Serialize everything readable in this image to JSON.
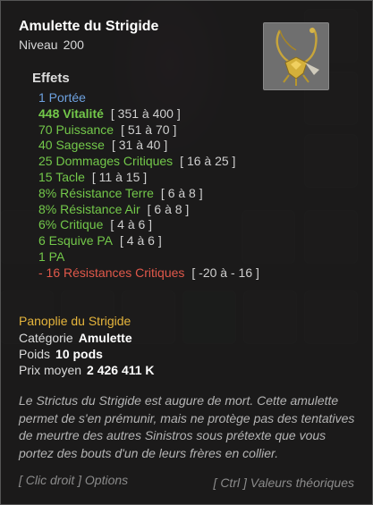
{
  "item": {
    "name": "Amulette du Strigide",
    "level_label": "Niveau",
    "level": "200"
  },
  "effects": {
    "title": "Effets",
    "lines": [
      {
        "text": "1 Portée",
        "range": "",
        "color": "blue",
        "bold": false
      },
      {
        "text": "448 Vitalité",
        "range": "[ 351 à 400 ]",
        "color": "green",
        "bold": true
      },
      {
        "text": "70 Puissance",
        "range": "[ 51 à 70 ]",
        "color": "green",
        "bold": false
      },
      {
        "text": "40 Sagesse",
        "range": "[ 31 à 40 ]",
        "color": "green",
        "bold": false
      },
      {
        "text": "25 Dommages Critiques",
        "range": "[ 16 à 25 ]",
        "color": "green",
        "bold": false
      },
      {
        "text": "15 Tacle",
        "range": "[ 11 à 15 ]",
        "color": "green",
        "bold": false
      },
      {
        "text": "8% Résistance Terre",
        "range": "[ 6 à 8 ]",
        "color": "green",
        "bold": false
      },
      {
        "text": "8% Résistance Air",
        "range": "[ 6 à 8 ]",
        "color": "green",
        "bold": false
      },
      {
        "text": "6% Critique",
        "range": "[ 4 à 6 ]",
        "color": "green",
        "bold": false
      },
      {
        "text": "6 Esquive PA",
        "range": "[ 4 à 6 ]",
        "color": "green",
        "bold": false
      },
      {
        "text": "1 PA",
        "range": "",
        "color": "green",
        "bold": false
      },
      {
        "text": "- 16 Résistances Critiques",
        "range": "[ -20 à - 16 ]",
        "color": "red",
        "bold": false
      }
    ]
  },
  "set": {
    "name": "Panoplie du Strigide"
  },
  "details": {
    "category_label": "Catégorie",
    "category_value": "Amulette",
    "weight_label": "Poids",
    "weight_value": "10 pods",
    "price_label": "Prix moyen",
    "price_value": "2 426 411 K"
  },
  "description": "Le Strictus du Strigide est augure de mort. Cette amulette permet de s'en prémunir, mais ne protège pas des tentatives de meurtre des autres Sinistros sous prétexte que vous portez des bouts d'un de leurs frères en collier.",
  "hints": {
    "left": "[ Clic droit ] Options",
    "right": "[ Ctrl ] Valeurs théoriques"
  },
  "colors": {
    "blue": "#6ea2e0",
    "green": "#73c84a",
    "red": "#e0584a",
    "gold": "#e6b53c"
  }
}
